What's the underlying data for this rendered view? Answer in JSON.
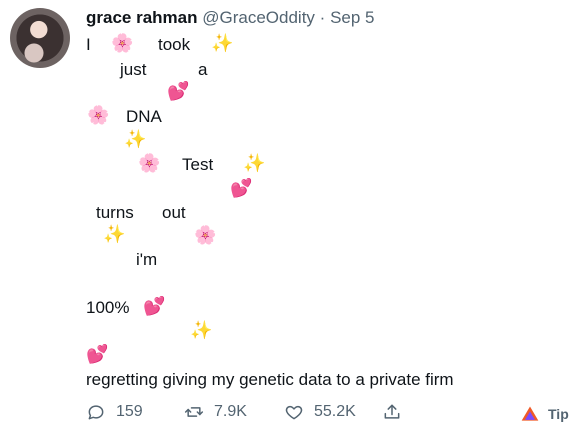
{
  "tweet": {
    "author_name": "grace rahman",
    "handle": "@GraceOddity",
    "separator": "·",
    "date": "Sep 5",
    "words": {
      "w1": "I",
      "w2": "took",
      "w3": "just",
      "w4": "a",
      "w5": "DNA",
      "w6": "Test",
      "w7": "turns",
      "w8": "out",
      "w9": "i'm",
      "w10": "100%"
    },
    "final_line": "regretting giving my genetic data to a private firm",
    "emoji": {
      "blossom": "🌸",
      "sparkles": "✨",
      "heart": "💕"
    }
  },
  "actions": {
    "replies": "159",
    "retweets": "7.9K",
    "likes": "55.2K",
    "tip_label": "Tip"
  },
  "colors": {
    "text": "#0f1419",
    "muted": "#536471",
    "heart": "#dd2e44",
    "sparkles": "#f4b400",
    "blossom": "#f4a7b9"
  }
}
